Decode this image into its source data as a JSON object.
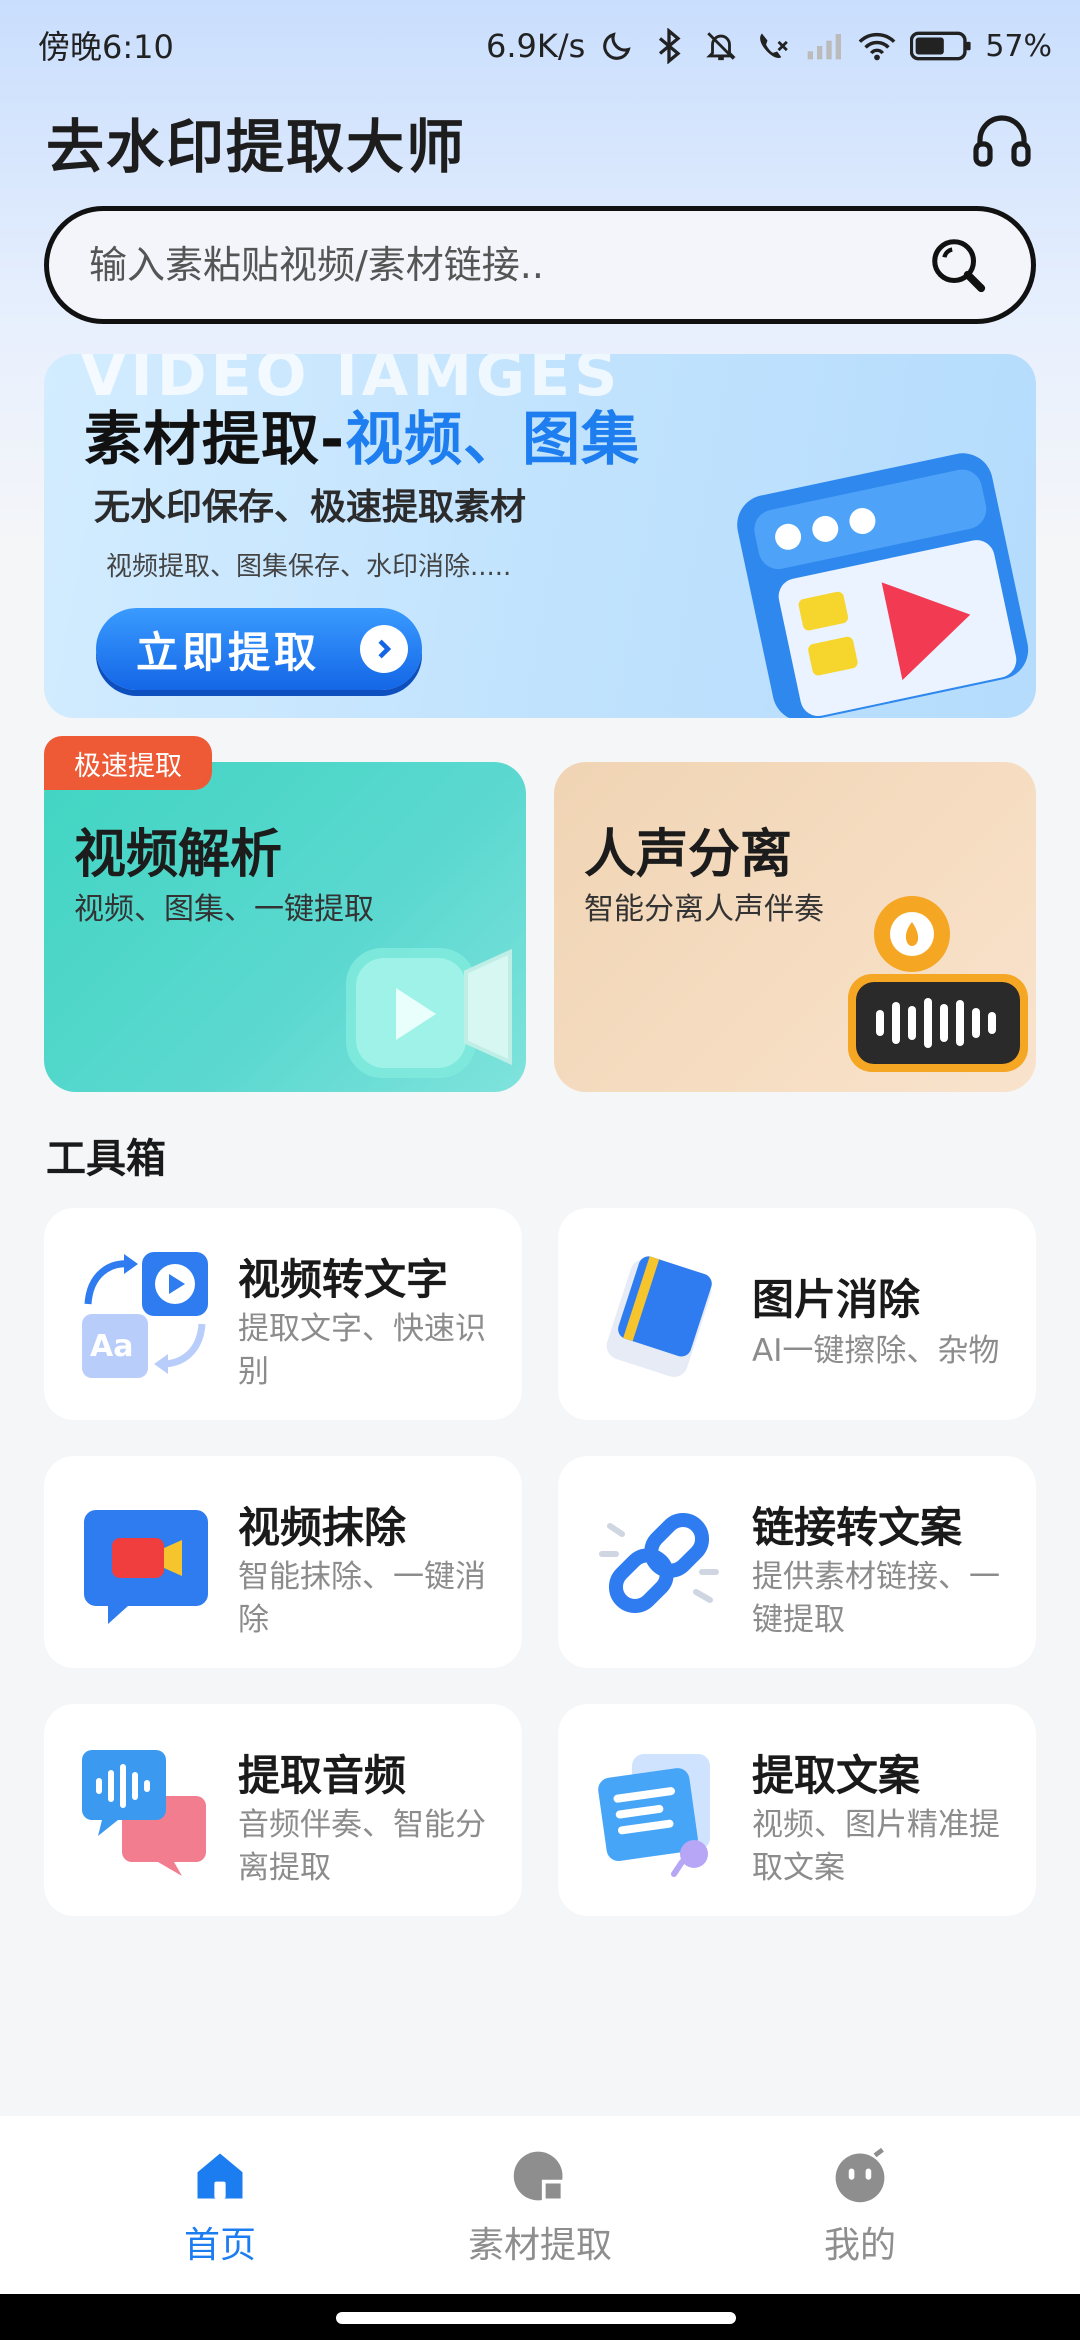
{
  "status_bar": {
    "time": "傍晚6:10",
    "net_speed": "6.9K/s",
    "battery": "57%",
    "icons": [
      "moon-icon",
      "bluetooth-icon",
      "bell-off-icon",
      "call-off-icon",
      "signal-icon",
      "wifi-icon",
      "battery-icon"
    ]
  },
  "header": {
    "title": "去水印提取大师",
    "headset_icon": "headset-icon"
  },
  "search": {
    "placeholder": "输入素粘贴视频/素材链接..",
    "value": "",
    "icon": "search-icon"
  },
  "banner": {
    "bg_text": "VIDEO  IAMGES",
    "title_prefix": "素材提取-",
    "title_highlight": "视频、图集",
    "subtitle": "无水印保存、极速提取素材",
    "desc": "视频提取、图集保存、水印消除.....",
    "button_label": "立即提取"
  },
  "features": {
    "badge": "极速提取",
    "video": {
      "title": "视频解析",
      "sub": "视频、图集、一键提取"
    },
    "voice": {
      "title": "人声分离",
      "sub": "智能分离人声伴奏"
    }
  },
  "toolbox": {
    "title": "工具箱",
    "items": [
      {
        "title": "视频转文字",
        "desc": "提取文字、快速识别",
        "icon": "video-to-text-icon"
      },
      {
        "title": "图片消除",
        "desc": "AI一键擦除、杂物",
        "icon": "eraser-icon"
      },
      {
        "title": "视频抹除",
        "desc": "智能抹除、一键消除",
        "icon": "video-erase-icon"
      },
      {
        "title": "链接转文案",
        "desc": "提供素材链接、一键提取",
        "icon": "link-icon"
      },
      {
        "title": "提取音频",
        "desc": "音频伴奏、智能分离提取",
        "icon": "audio-extract-icon"
      },
      {
        "title": "提取文案",
        "desc": "视频、图片精准提取文案",
        "icon": "copy-extract-icon"
      }
    ]
  },
  "bottom_nav": {
    "items": [
      {
        "label": "首页",
        "icon": "home-icon",
        "active": true
      },
      {
        "label": "素材提取",
        "icon": "extract-icon",
        "active": false
      },
      {
        "label": "我的",
        "icon": "profile-icon",
        "active": false
      }
    ]
  },
  "colors": {
    "accent": "#1c7df0",
    "badge": "#ee5a35",
    "video_card": "#4fd6c8",
    "voice_card": "#f3d8bb"
  }
}
